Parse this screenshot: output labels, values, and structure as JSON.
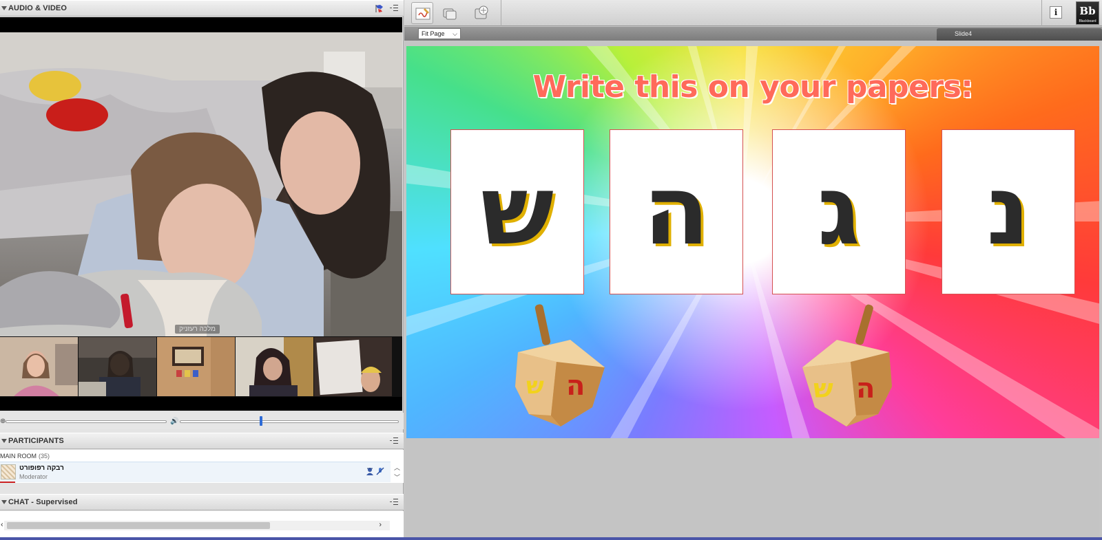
{
  "audio_video": {
    "title": "AUDIO & VIDEO",
    "camera_name": "מלכה רעזניק"
  },
  "participants": {
    "title": "PARTICIPANTS",
    "room_label": "MAIN ROOM",
    "room_count": "(35)",
    "list": [
      {
        "name": "רבקה רפופורט",
        "role": "Moderator"
      }
    ]
  },
  "chat": {
    "title": "CHAT - Supervised"
  },
  "toolbar": {
    "info_label": "i",
    "logo_text": "Bb",
    "logo_sub": "Blackboard"
  },
  "slide_bar": {
    "fit_selected": "Fit Page",
    "slide_name": "Slide4"
  },
  "slide": {
    "title": "Write this on your papers:",
    "letters": [
      "ש",
      "ה",
      "ג",
      "נ"
    ]
  },
  "colors": {
    "slide_title": "#ff6a5a",
    "card_border": "#d45050",
    "letter_shadow": "#e0b000",
    "slider_thumb": "#2e6bd6"
  },
  "controls": {
    "mic_level": 0.0,
    "speaker_volume": 0.37
  }
}
